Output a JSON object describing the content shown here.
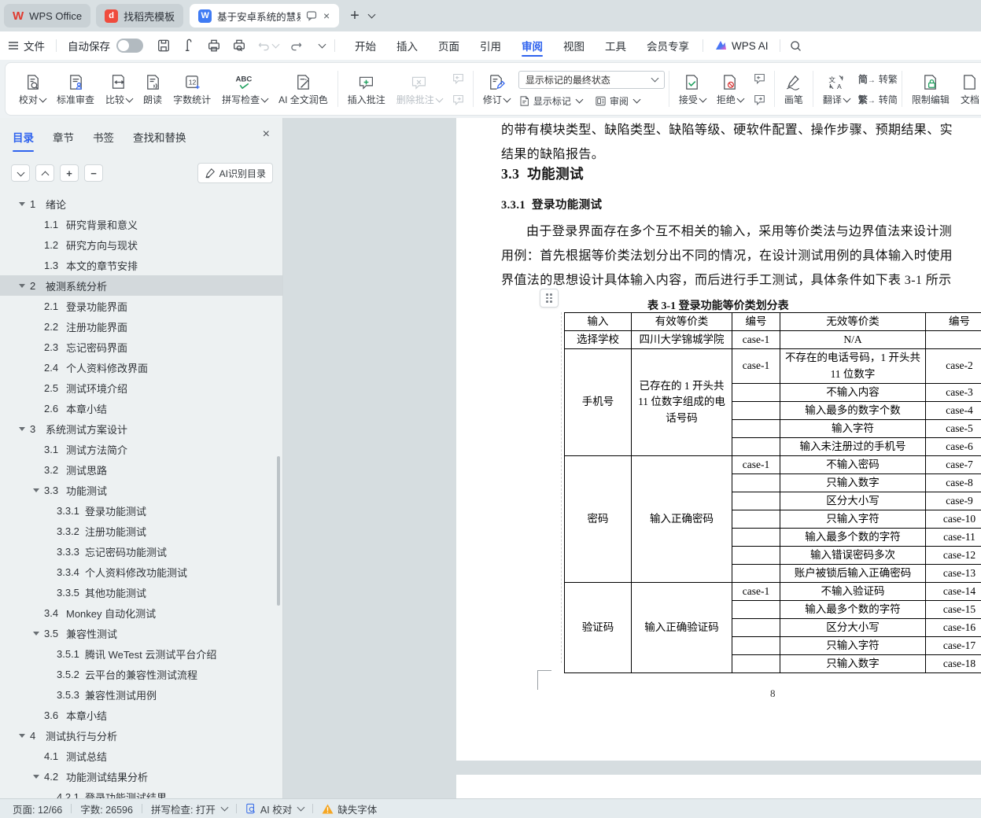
{
  "tab_bar": {
    "tabs": [
      {
        "label": "WPS Office"
      },
      {
        "label": "找稻壳模板"
      },
      {
        "label": "基于安卓系统的慧易联app的",
        "active": true
      }
    ]
  },
  "menu_bar": {
    "file_label": "文件",
    "autosave": {
      "label": "自动保存",
      "state": "off"
    },
    "tabs": [
      "开始",
      "插入",
      "页面",
      "引用",
      "审阅",
      "视图",
      "工具",
      "会员专享"
    ],
    "active_tab": "审阅",
    "wps_ai_label": "WPS AI"
  },
  "ribbon": {
    "proofread": "校对",
    "standard_review": "标准审查",
    "compare": "比较",
    "read_aloud": "朗读",
    "word_count": "字数统计",
    "spell_check": "拼写检查",
    "ai_polish": "AI 全文润色",
    "insert_comment": "插入批注",
    "delete_comment": "删除批注",
    "track_changes": "修订",
    "marks_dropdown_value": "显示标记的最终状态",
    "show_marks": "显示标记",
    "review_pane": "审阅",
    "accept": "接受",
    "reject": "拒绝",
    "brush": "画笔",
    "translate": "翻译",
    "jian_glyph": "简",
    "fan_glyph": "繁",
    "to_traditional": "转繁",
    "to_simplified": "转简",
    "restrict_edit": "限制编辑",
    "doc_partial": "文档"
  },
  "sidebar": {
    "tabs": [
      "目录",
      "章节",
      "书签",
      "查找和替换"
    ],
    "active_tab": "目录",
    "ai_button_label": "AI识别目录",
    "toc": [
      {
        "level": 1,
        "arrow": true,
        "num": "1",
        "text": "绪论"
      },
      {
        "level": 2,
        "arrow": false,
        "num": "1.1",
        "text": "研究背景和意义"
      },
      {
        "level": 2,
        "arrow": false,
        "num": "1.2",
        "text": "研究方向与现状"
      },
      {
        "level": 2,
        "arrow": false,
        "num": "1.3",
        "text": "本文的章节安排"
      },
      {
        "level": 1,
        "arrow": true,
        "num": "2",
        "text": "被测系统分析",
        "selected": true
      },
      {
        "level": 2,
        "arrow": false,
        "num": "2.1",
        "text": "登录功能界面"
      },
      {
        "level": 2,
        "arrow": false,
        "num": "2.2",
        "text": "注册功能界面"
      },
      {
        "level": 2,
        "arrow": false,
        "num": "2.3",
        "text": "忘记密码界面"
      },
      {
        "level": 2,
        "arrow": false,
        "num": "2.4",
        "text": "个人资料修改界面"
      },
      {
        "level": 2,
        "arrow": false,
        "num": "2.5",
        "text": "测试环境介绍"
      },
      {
        "level": 2,
        "arrow": false,
        "num": "2.6",
        "text": "本章小结"
      },
      {
        "level": 1,
        "arrow": true,
        "num": "3",
        "text": "系统测试方案设计"
      },
      {
        "level": 2,
        "arrow": false,
        "num": "3.1",
        "text": "测试方法简介"
      },
      {
        "level": 2,
        "arrow": false,
        "num": "3.2",
        "text": "测试思路"
      },
      {
        "level": 2,
        "arrow": true,
        "num": "3.3",
        "text": "功能测试"
      },
      {
        "level": 3,
        "arrow": false,
        "num": "3.3.1",
        "text": "登录功能测试"
      },
      {
        "level": 3,
        "arrow": false,
        "num": "3.3.2",
        "text": "注册功能测试"
      },
      {
        "level": 3,
        "arrow": false,
        "num": "3.3.3",
        "text": "忘记密码功能测试"
      },
      {
        "level": 3,
        "arrow": false,
        "num": "3.3.4",
        "text": "个人资料修改功能测试"
      },
      {
        "level": 3,
        "arrow": false,
        "num": "3.3.5",
        "text": "其他功能测试"
      },
      {
        "level": 2,
        "arrow": false,
        "num": "3.4",
        "text": "Monkey 自动化测试"
      },
      {
        "level": 2,
        "arrow": true,
        "num": "3.5",
        "text": "兼容性测试"
      },
      {
        "level": 3,
        "arrow": false,
        "num": "3.5.1",
        "text": "腾讯 WeTest 云测试平台介绍"
      },
      {
        "level": 3,
        "arrow": false,
        "num": "3.5.2",
        "text": "云平台的兼容性测试流程"
      },
      {
        "level": 3,
        "arrow": false,
        "num": "3.5.3",
        "text": "兼容性测试用例"
      },
      {
        "level": 2,
        "arrow": false,
        "num": "3.6",
        "text": "本章小结"
      },
      {
        "level": 1,
        "arrow": true,
        "num": "4",
        "text": "测试执行与分析"
      },
      {
        "level": 2,
        "arrow": false,
        "num": "4.1",
        "text": "测试总结"
      },
      {
        "level": 2,
        "arrow": true,
        "num": "4.2",
        "text": "功能测试结果分析"
      },
      {
        "level": 3,
        "arrow": false,
        "num": "4.2.1",
        "text": "登录功能测试结果"
      }
    ]
  },
  "document": {
    "top_line1": "的带有模块类型、缺陷类型、缺陷等级、硬软件配置、操作步骤、预期结果、实",
    "top_line2": "结果的缺陷报告。",
    "heading": "3.3  功能测试",
    "subheading": "3.3.1  登录功能测试",
    "para_line1": "由于登录界面存在多个互不相关的输入，采用等价类法与边界值法来设计测",
    "para_line2": "用例：首先根据等价类法划分出不同的情况，在设计测试用例的具体输入时使用",
    "para_line3": "界值法的思想设计具体输入内容，而后进行手工测试，具体条件如下表 3-1 所示",
    "table_caption": "表 3-1 登录功能等价类划分表",
    "page_number": "8",
    "table": {
      "headers": [
        "输入",
        "有效等价类",
        "编号",
        "无效等价类",
        "编号"
      ],
      "groups": [
        {
          "input": "选择学校",
          "valid": "四川大学锦城学院",
          "valid_case": "case-1",
          "rows": [
            {
              "invalid": "N/A",
              "case": ""
            }
          ]
        },
        {
          "input": "手机号",
          "valid": "已存在的 1 开头共 11 位数字组成的电话号码",
          "valid_case": "case-1",
          "rows": [
            {
              "invalid": "不存在的电话号码，1 开头共 11 位数字",
              "case": "case-2",
              "tall": true
            },
            {
              "invalid": "不输入内容",
              "case": "case-3"
            },
            {
              "invalid": "输入最多的数字个数",
              "case": "case-4"
            },
            {
              "invalid": "输入字符",
              "case": "case-5"
            },
            {
              "invalid": "输入未注册过的手机号",
              "case": "case-6"
            }
          ]
        },
        {
          "input": "密码",
          "valid": "输入正确密码",
          "valid_case": "case-1",
          "rows": [
            {
              "invalid": "不输入密码",
              "case": "case-7"
            },
            {
              "invalid": "只输入数字",
              "case": "case-8"
            },
            {
              "invalid": "区分大小写",
              "case": "case-9"
            },
            {
              "invalid": "只输入字符",
              "case": "case-10"
            },
            {
              "invalid": "输入最多个数的字符",
              "case": "case-11"
            },
            {
              "invalid": "输入错误密码多次",
              "case": "case-12"
            },
            {
              "invalid": "账户被锁后输入正确密码",
              "case": "case-13"
            }
          ]
        },
        {
          "input": "验证码",
          "valid": "输入正确验证码",
          "valid_case": "case-1",
          "rows": [
            {
              "invalid": "不输入验证码",
              "case": "case-14"
            },
            {
              "invalid": "输入最多个数的字符",
              "case": "case-15"
            },
            {
              "invalid": "区分大小写",
              "case": "case-16"
            },
            {
              "invalid": "只输入字符",
              "case": "case-17"
            },
            {
              "invalid": "只输入数字",
              "case": "case-18"
            }
          ]
        }
      ]
    }
  },
  "status_bar": {
    "page_label": "页面: 12/66",
    "word_count_label": "字数: 26596",
    "spellcheck_label": "拼写检查: 打开",
    "ai_proof_label": "AI 校对",
    "missing_font_label": "缺失字体"
  }
}
